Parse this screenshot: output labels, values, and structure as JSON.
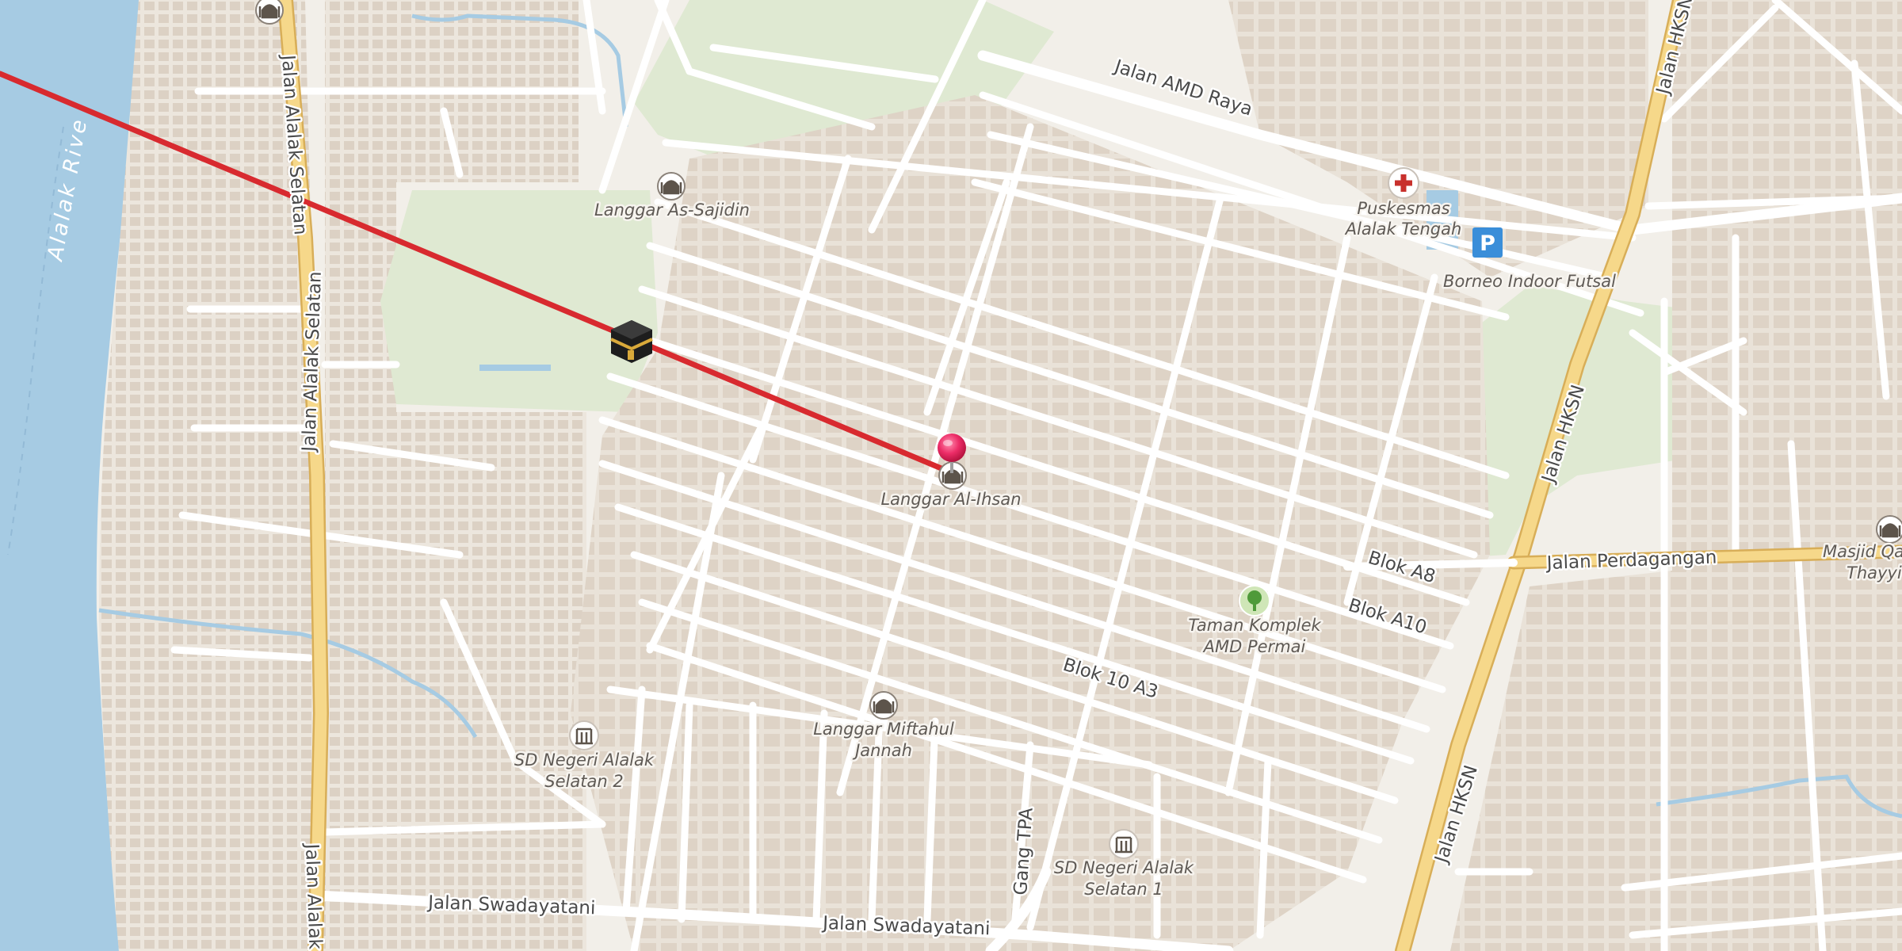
{
  "map": {
    "water_label": "Alalak Rive",
    "colors": {
      "background": "#f2efe9",
      "water": "#a6cbe3",
      "park": "#dfe9d2",
      "building": "#e2d9cf",
      "primary_road": "#f3d27d",
      "qibla_line": "#d82a2f",
      "marker": "#e8265f",
      "parking": "#3a8ed9"
    },
    "roads": {
      "alalak_selatan_1": "Jalan Alalak Selatan",
      "alalak_selatan_2": "Jalan Alalak Selatan",
      "alalak_selatan_3": "Jalan Alalak",
      "amd_raya": "Jalan AMD Raya",
      "hksn_1": "Jalan HKSN",
      "hksn_2": "Jalan HKSN",
      "hksn_3": "Jalan HKSN",
      "perdagangan": "Jalan Perdagangan",
      "blok_a8": "Blok A8",
      "blok_a10": "Blok A10",
      "blok_10_a3": "Blok 10 A3",
      "gang_tpa": "Gang TPA",
      "swadayatani_1": "Jalan Swadayatani",
      "swadayatani_2": "Jalan Swadayatani"
    },
    "pois": {
      "as_sajidin": "Langgar As-Sajidin",
      "al_ihsan": "Langgar Al-Ihsan",
      "puskesmas_1": "Puskesmas",
      "puskesmas_2": "Alalak Tengah",
      "borneo_futsal": "Borneo Indoor Futsal",
      "taman_1": "Taman Komplek",
      "taman_2": "AMD Permai",
      "miftahul_1": "Langgar Miftahul",
      "miftahul_2": "Jannah",
      "sd2_1": "SD Negeri Alalak",
      "sd2_2": "Selatan 2",
      "sd1_1": "SD Negeri Alalak",
      "sd1_2": "Selatan 1",
      "masjid_1": "Masjid Qa",
      "masjid_2": "Thayyi"
    },
    "icons": {
      "mosque": "mosque-icon",
      "kaaba": "kaaba-icon",
      "hospital": "hospital-icon",
      "parking": "parking-icon",
      "park": "tree-icon",
      "school": "school-icon",
      "marker": "location-pin-icon"
    }
  }
}
